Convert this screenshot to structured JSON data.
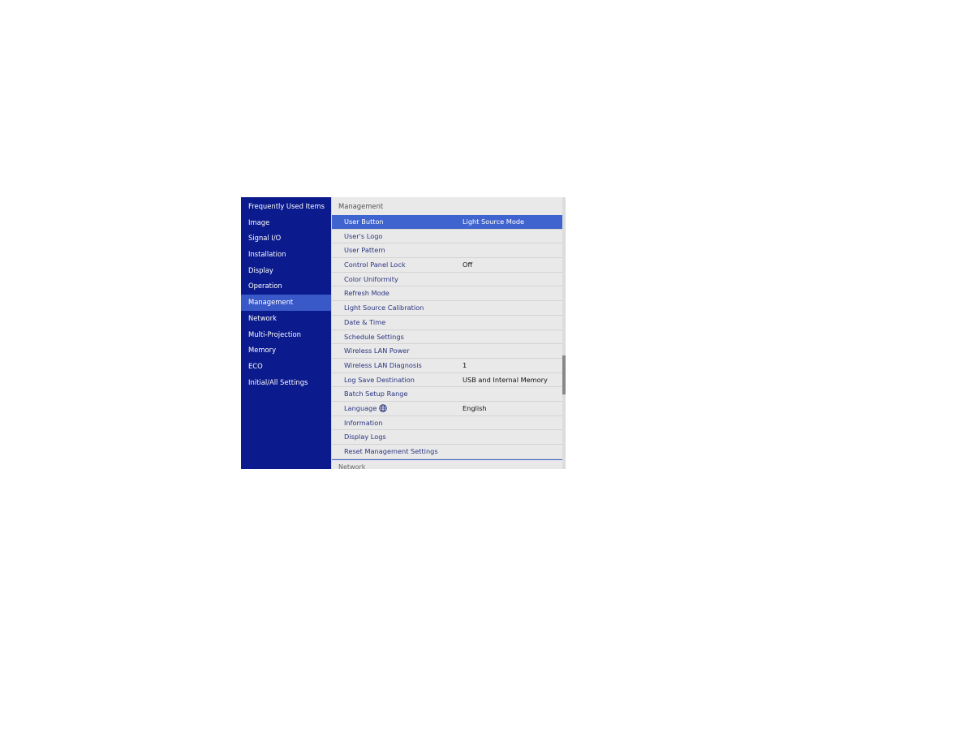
{
  "sidebar": {
    "items": [
      {
        "label": "Frequently Used Items",
        "active": false
      },
      {
        "label": "Image",
        "active": false
      },
      {
        "label": "Signal I/O",
        "active": false
      },
      {
        "label": "Installation",
        "active": false
      },
      {
        "label": "Display",
        "active": false
      },
      {
        "label": "Operation",
        "active": false
      },
      {
        "label": "Management",
        "active": true
      },
      {
        "label": "Network",
        "active": false
      },
      {
        "label": "Multi-Projection",
        "active": false
      },
      {
        "label": "Memory",
        "active": false
      },
      {
        "label": "ECO",
        "active": false
      },
      {
        "label": "Initial/All Settings",
        "active": false
      }
    ]
  },
  "panel": {
    "section_title": "Management",
    "rows": [
      {
        "label": "User Button",
        "value": "Light Source Mode",
        "selected": true
      },
      {
        "label": "User's Logo",
        "value": ""
      },
      {
        "label": "User Pattern",
        "value": ""
      },
      {
        "label": "Control Panel Lock",
        "value": "Off"
      },
      {
        "label": "Color Uniformity",
        "value": ""
      },
      {
        "label": "Refresh Mode",
        "value": ""
      },
      {
        "label": "Light Source Calibration",
        "value": ""
      },
      {
        "label": "Date & Time",
        "value": ""
      },
      {
        "label": "Schedule Settings",
        "value": ""
      },
      {
        "label": "Wireless LAN Power",
        "value": ""
      },
      {
        "label": "Wireless LAN Diagnosis",
        "value": "1"
      },
      {
        "label": "Log Save Destination",
        "value": "USB and Internal Memory"
      },
      {
        "label": "Batch Setup Range",
        "value": ""
      },
      {
        "label": "Language",
        "value": "English",
        "icon": "globe-icon"
      },
      {
        "label": "Information",
        "value": ""
      },
      {
        "label": "Display Logs",
        "value": ""
      },
      {
        "label": "Reset Management Settings",
        "value": ""
      }
    ],
    "next_section_title": "Network",
    "scroll_position": 0.68
  }
}
